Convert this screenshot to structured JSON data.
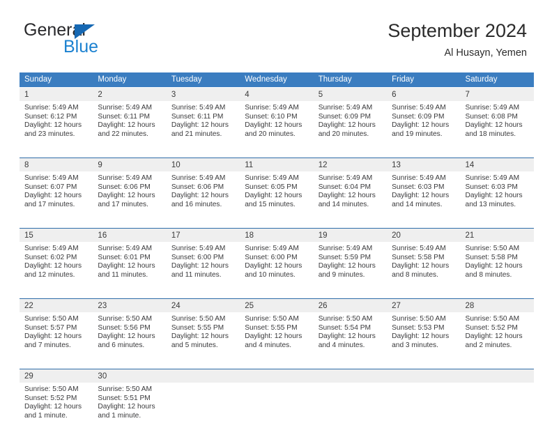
{
  "brand": {
    "name_top": "General",
    "name_bottom": "Blue",
    "triangle_color": "#1668b3",
    "blue_color": "#1b81d0"
  },
  "header": {
    "title": "September 2024",
    "subtitle": "Al Husayn, Yemen"
  },
  "theme": {
    "header_row_bg": "#3b7dc0",
    "daynum_bg": "#efefef",
    "week_separator": "#2d6ca8",
    "text": "#39393b"
  },
  "labels": {
    "sunrise_prefix": "Sunrise:",
    "sunset_prefix": "Sunset:",
    "daylight_prefix": "Daylight:"
  },
  "weekdays": [
    "Sunday",
    "Monday",
    "Tuesday",
    "Wednesday",
    "Thursday",
    "Friday",
    "Saturday"
  ],
  "weeks": [
    {
      "days": [
        {
          "num": "1",
          "sunrise": "Sunrise: 5:49 AM",
          "sunset": "Sunset: 6:12 PM",
          "daylight1": "Daylight: 12 hours",
          "daylight2": "and 23 minutes."
        },
        {
          "num": "2",
          "sunrise": "Sunrise: 5:49 AM",
          "sunset": "Sunset: 6:11 PM",
          "daylight1": "Daylight: 12 hours",
          "daylight2": "and 22 minutes."
        },
        {
          "num": "3",
          "sunrise": "Sunrise: 5:49 AM",
          "sunset": "Sunset: 6:11 PM",
          "daylight1": "Daylight: 12 hours",
          "daylight2": "and 21 minutes."
        },
        {
          "num": "4",
          "sunrise": "Sunrise: 5:49 AM",
          "sunset": "Sunset: 6:10 PM",
          "daylight1": "Daylight: 12 hours",
          "daylight2": "and 20 minutes."
        },
        {
          "num": "5",
          "sunrise": "Sunrise: 5:49 AM",
          "sunset": "Sunset: 6:09 PM",
          "daylight1": "Daylight: 12 hours",
          "daylight2": "and 20 minutes."
        },
        {
          "num": "6",
          "sunrise": "Sunrise: 5:49 AM",
          "sunset": "Sunset: 6:09 PM",
          "daylight1": "Daylight: 12 hours",
          "daylight2": "and 19 minutes."
        },
        {
          "num": "7",
          "sunrise": "Sunrise: 5:49 AM",
          "sunset": "Sunset: 6:08 PM",
          "daylight1": "Daylight: 12 hours",
          "daylight2": "and 18 minutes."
        }
      ]
    },
    {
      "days": [
        {
          "num": "8",
          "sunrise": "Sunrise: 5:49 AM",
          "sunset": "Sunset: 6:07 PM",
          "daylight1": "Daylight: 12 hours",
          "daylight2": "and 17 minutes."
        },
        {
          "num": "9",
          "sunrise": "Sunrise: 5:49 AM",
          "sunset": "Sunset: 6:06 PM",
          "daylight1": "Daylight: 12 hours",
          "daylight2": "and 17 minutes."
        },
        {
          "num": "10",
          "sunrise": "Sunrise: 5:49 AM",
          "sunset": "Sunset: 6:06 PM",
          "daylight1": "Daylight: 12 hours",
          "daylight2": "and 16 minutes."
        },
        {
          "num": "11",
          "sunrise": "Sunrise: 5:49 AM",
          "sunset": "Sunset: 6:05 PM",
          "daylight1": "Daylight: 12 hours",
          "daylight2": "and 15 minutes."
        },
        {
          "num": "12",
          "sunrise": "Sunrise: 5:49 AM",
          "sunset": "Sunset: 6:04 PM",
          "daylight1": "Daylight: 12 hours",
          "daylight2": "and 14 minutes."
        },
        {
          "num": "13",
          "sunrise": "Sunrise: 5:49 AM",
          "sunset": "Sunset: 6:03 PM",
          "daylight1": "Daylight: 12 hours",
          "daylight2": "and 14 minutes."
        },
        {
          "num": "14",
          "sunrise": "Sunrise: 5:49 AM",
          "sunset": "Sunset: 6:03 PM",
          "daylight1": "Daylight: 12 hours",
          "daylight2": "and 13 minutes."
        }
      ]
    },
    {
      "days": [
        {
          "num": "15",
          "sunrise": "Sunrise: 5:49 AM",
          "sunset": "Sunset: 6:02 PM",
          "daylight1": "Daylight: 12 hours",
          "daylight2": "and 12 minutes."
        },
        {
          "num": "16",
          "sunrise": "Sunrise: 5:49 AM",
          "sunset": "Sunset: 6:01 PM",
          "daylight1": "Daylight: 12 hours",
          "daylight2": "and 11 minutes."
        },
        {
          "num": "17",
          "sunrise": "Sunrise: 5:49 AM",
          "sunset": "Sunset: 6:00 PM",
          "daylight1": "Daylight: 12 hours",
          "daylight2": "and 11 minutes."
        },
        {
          "num": "18",
          "sunrise": "Sunrise: 5:49 AM",
          "sunset": "Sunset: 6:00 PM",
          "daylight1": "Daylight: 12 hours",
          "daylight2": "and 10 minutes."
        },
        {
          "num": "19",
          "sunrise": "Sunrise: 5:49 AM",
          "sunset": "Sunset: 5:59 PM",
          "daylight1": "Daylight: 12 hours",
          "daylight2": "and 9 minutes."
        },
        {
          "num": "20",
          "sunrise": "Sunrise: 5:49 AM",
          "sunset": "Sunset: 5:58 PM",
          "daylight1": "Daylight: 12 hours",
          "daylight2": "and 8 minutes."
        },
        {
          "num": "21",
          "sunrise": "Sunrise: 5:50 AM",
          "sunset": "Sunset: 5:58 PM",
          "daylight1": "Daylight: 12 hours",
          "daylight2": "and 8 minutes."
        }
      ]
    },
    {
      "days": [
        {
          "num": "22",
          "sunrise": "Sunrise: 5:50 AM",
          "sunset": "Sunset: 5:57 PM",
          "daylight1": "Daylight: 12 hours",
          "daylight2": "and 7 minutes."
        },
        {
          "num": "23",
          "sunrise": "Sunrise: 5:50 AM",
          "sunset": "Sunset: 5:56 PM",
          "daylight1": "Daylight: 12 hours",
          "daylight2": "and 6 minutes."
        },
        {
          "num": "24",
          "sunrise": "Sunrise: 5:50 AM",
          "sunset": "Sunset: 5:55 PM",
          "daylight1": "Daylight: 12 hours",
          "daylight2": "and 5 minutes."
        },
        {
          "num": "25",
          "sunrise": "Sunrise: 5:50 AM",
          "sunset": "Sunset: 5:55 PM",
          "daylight1": "Daylight: 12 hours",
          "daylight2": "and 4 minutes."
        },
        {
          "num": "26",
          "sunrise": "Sunrise: 5:50 AM",
          "sunset": "Sunset: 5:54 PM",
          "daylight1": "Daylight: 12 hours",
          "daylight2": "and 4 minutes."
        },
        {
          "num": "27",
          "sunrise": "Sunrise: 5:50 AM",
          "sunset": "Sunset: 5:53 PM",
          "daylight1": "Daylight: 12 hours",
          "daylight2": "and 3 minutes."
        },
        {
          "num": "28",
          "sunrise": "Sunrise: 5:50 AM",
          "sunset": "Sunset: 5:52 PM",
          "daylight1": "Daylight: 12 hours",
          "daylight2": "and 2 minutes."
        }
      ]
    },
    {
      "days": [
        {
          "num": "29",
          "sunrise": "Sunrise: 5:50 AM",
          "sunset": "Sunset: 5:52 PM",
          "daylight1": "Daylight: 12 hours",
          "daylight2": "and 1 minute."
        },
        {
          "num": "30",
          "sunrise": "Sunrise: 5:50 AM",
          "sunset": "Sunset: 5:51 PM",
          "daylight1": "Daylight: 12 hours",
          "daylight2": "and 1 minute."
        },
        {
          "num": "",
          "sunrise": "",
          "sunset": "",
          "daylight1": "",
          "daylight2": ""
        },
        {
          "num": "",
          "sunrise": "",
          "sunset": "",
          "daylight1": "",
          "daylight2": ""
        },
        {
          "num": "",
          "sunrise": "",
          "sunset": "",
          "daylight1": "",
          "daylight2": ""
        },
        {
          "num": "",
          "sunrise": "",
          "sunset": "",
          "daylight1": "",
          "daylight2": ""
        },
        {
          "num": "",
          "sunrise": "",
          "sunset": "",
          "daylight1": "",
          "daylight2": ""
        }
      ]
    }
  ]
}
